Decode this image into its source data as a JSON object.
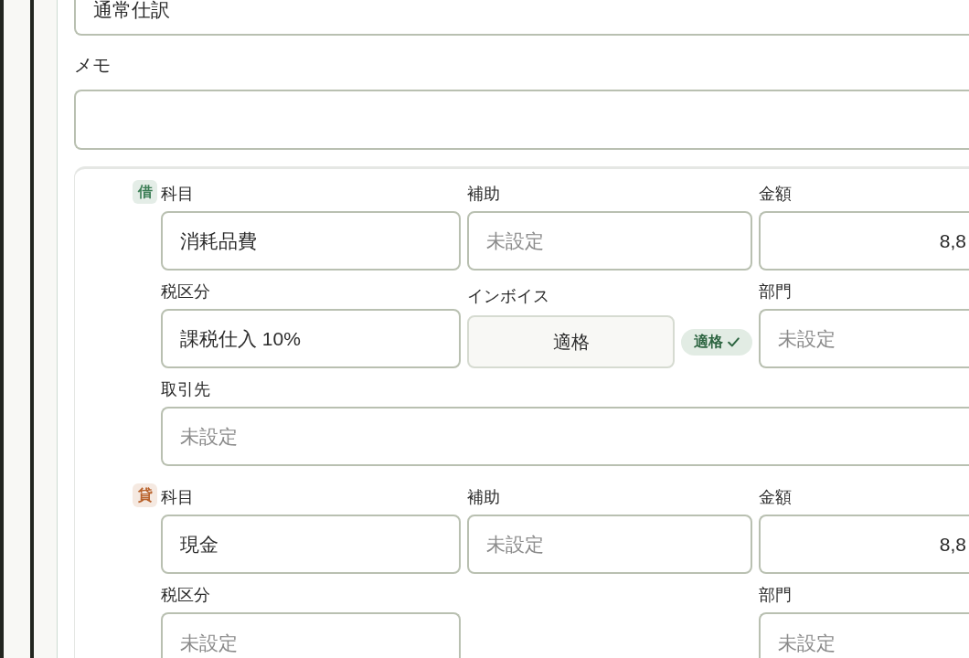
{
  "type_field": {
    "value": "通常仕訳"
  },
  "memo": {
    "label": "メモ"
  },
  "entries": [
    {
      "side": "借",
      "color": "#3b7d55",
      "account": {
        "label": "科目",
        "value": "消耗品費"
      },
      "sub_account": {
        "label": "補助",
        "placeholder": "未設定"
      },
      "amount": {
        "label": "金額",
        "value": "8,8"
      },
      "tax_category": {
        "label": "税区分",
        "value": "課税仕入 10%"
      },
      "invoice": {
        "label": "インボイス",
        "button": "適格",
        "status": "適格"
      },
      "department": {
        "label": "部門",
        "placeholder": "未設定"
      },
      "partner": {
        "label": "取引先",
        "placeholder": "未設定"
      }
    },
    {
      "side": "貸",
      "color": "#b8612a",
      "account": {
        "label": "科目",
        "value": "現金"
      },
      "sub_account": {
        "label": "補助",
        "placeholder": "未設定"
      },
      "amount": {
        "label": "金額",
        "value": "8,8"
      },
      "tax_category": {
        "label": "税区分",
        "placeholder": "未設定"
      },
      "department": {
        "label": "部門",
        "placeholder": "未設定"
      }
    }
  ]
}
